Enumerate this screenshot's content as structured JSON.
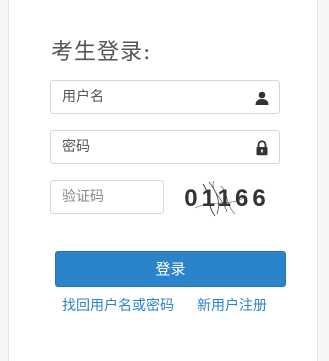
{
  "login": {
    "title": "考生登录:",
    "username": {
      "value": "",
      "placeholder": "用户名",
      "icon": "user-icon"
    },
    "password": {
      "value": "",
      "placeholder": "密码",
      "icon": "lock-icon"
    },
    "captcha": {
      "value": "",
      "placeholder": "验证码",
      "image_text": "01166"
    },
    "submit_label": "登录",
    "links": {
      "forgot": "找回用户名或密码",
      "register": "新用户注册"
    }
  },
  "colors": {
    "accent": "#2a84cc",
    "panel": "#ffffff",
    "background": "#f5f5f5",
    "border": "#d7d7d7"
  }
}
